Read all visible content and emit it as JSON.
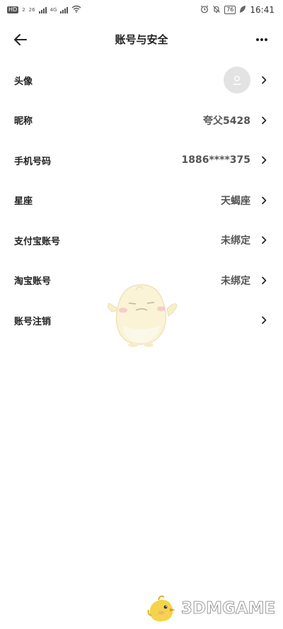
{
  "status_bar": {
    "hd_badge": "HD",
    "sim_label": "2",
    "net_4g_1": "26",
    "net_4g_2": "4G",
    "battery": "76",
    "time": "16:41"
  },
  "header": {
    "title": "账号与安全",
    "back_icon": "arrow-left-icon",
    "more_icon": "more-dots-icon"
  },
  "rows": [
    {
      "label": "头像",
      "value": ""
    },
    {
      "label": "昵称",
      "value": "夸父5428"
    },
    {
      "label": "手机号码",
      "value": "1886****375"
    },
    {
      "label": "星座",
      "value": "天蝎座"
    },
    {
      "label": "支付宝账号",
      "value": "未绑定"
    },
    {
      "label": "淘宝账号",
      "value": "未绑定"
    },
    {
      "label": "账号注销",
      "value": ""
    }
  ],
  "watermark": {
    "logo_text": "3DMGAME"
  },
  "colors": {
    "background": "#ffffff",
    "label": "#222222",
    "value": "#555555",
    "avatar_bg": "#e3e3e3"
  }
}
